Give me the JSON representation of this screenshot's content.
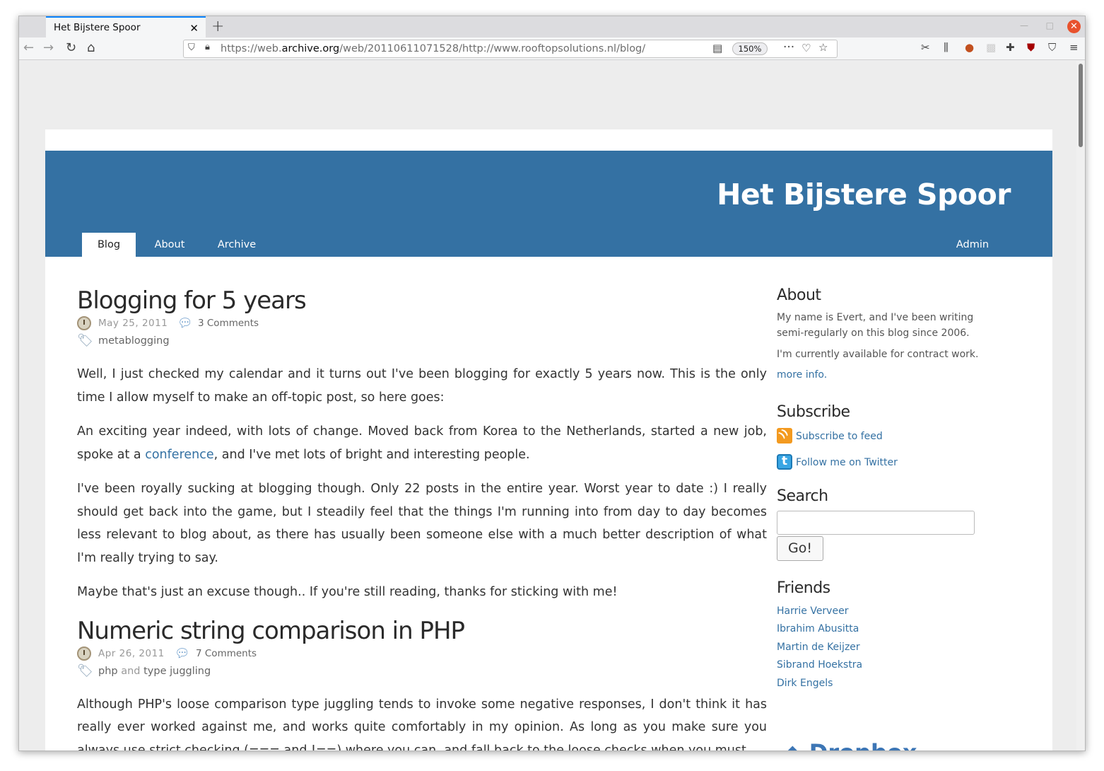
{
  "browser": {
    "tab_title": "Het Bijstere Spoor",
    "tab_close": "✕",
    "new_tab": "+",
    "url_prefix": "https://web.",
    "url_domain": "archive.org",
    "url_rest": "/web/20110611071528/http://www.rooftopsolutions.nl/blog/",
    "zoom": "150%"
  },
  "site": {
    "title": "Het Bijstere Spoor",
    "nav": [
      "Blog",
      "About",
      "Archive"
    ],
    "nav_right": "Admin"
  },
  "posts": [
    {
      "title": "Blogging for 5 years",
      "date": "May 25, 2011",
      "comments": "3 Comments",
      "tag1": "metablogging",
      "p1": "Well, I just checked my calendar and it turns out I've been blogging for exactly 5 years now. This is the only time I allow myself to make an off-topic post, so here goes:",
      "p2_before": "An exciting year indeed, with lots of change. Moved back from Korea to the Netherlands, started a new job, spoke at a ",
      "p2_link": "conference",
      "p2_after": ", and I've met lots of bright and interesting people.",
      "p3": "I've been royally sucking at blogging though. Only 22 posts in the entire year. Worst year to date :) I really should get back into the game, but I steadily feel that the things I'm running into from day to day becomes less relevant to blog about, as there has usually been someone else with a much better description of what I'm really trying to say.",
      "p4": "Maybe that's just an excuse though.. If you're still reading, thanks for sticking with me!"
    },
    {
      "title": "Numeric string comparison in PHP",
      "date": "Apr 26, 2011",
      "comments": "7 Comments",
      "tag1": "php",
      "tag_and": "and",
      "tag2": "type juggling",
      "p1": "Although PHP's loose comparison type juggling tends to invoke some negative responses, I don't think it has really ever worked against me, and works quite comfortably in my opinion. As long as you make sure you always use strict checking (=== and !==) where you can, and fall back to the loose checks when you must."
    }
  ],
  "sidebar": {
    "about_heading": "About",
    "about_text": "My name is Evert, and I've been writing semi-regularly on this blog since 2006.",
    "about_text2": "I'm currently available for contract work.",
    "about_link": "more info.",
    "subscribe_heading": "Subscribe",
    "feed_link": "Subscribe to feed",
    "twitter_link": "Follow me on Twitter",
    "search_heading": "Search",
    "search_value": "",
    "go_label": "Go!",
    "friends_heading": "Friends",
    "friends": [
      "Harrie Verveer",
      "Ibrahim Abusitta",
      "Martin de Keijzer",
      "Sibrand Hoekstra",
      "Dirk Engels"
    ],
    "dropbox_text": "Dropbox"
  }
}
